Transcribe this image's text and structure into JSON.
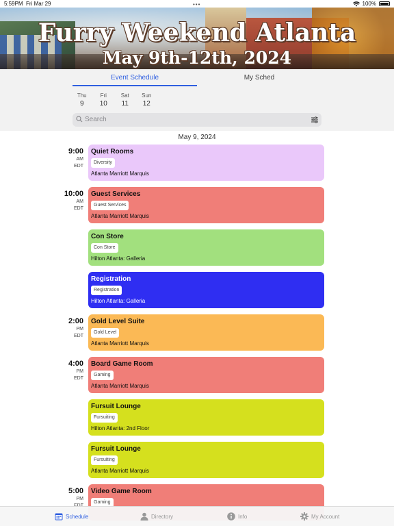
{
  "status": {
    "time": "5:59PM",
    "date": "Fri Mar 29",
    "battery": "100%"
  },
  "banner": {
    "title": "Furry Weekend Atlanta",
    "subtitle": "May 9th-12th, 2024"
  },
  "tabs": [
    {
      "label": "Event Schedule",
      "active": true
    },
    {
      "label": "My Sched",
      "active": false
    }
  ],
  "days": [
    {
      "dow": "Thu",
      "num": "9"
    },
    {
      "dow": "Fri",
      "num": "10"
    },
    {
      "dow": "Sat",
      "num": "11"
    },
    {
      "dow": "Sun",
      "num": "12"
    }
  ],
  "search": {
    "placeholder": "Search",
    "icon": "search-icon",
    "filter_icon": "filter-icon"
  },
  "date_heading": "May 9, 2024",
  "times": [
    {
      "hm": "9:00",
      "ampm": "AM",
      "tz": "EDT"
    },
    {
      "hm": "10:00",
      "ampm": "AM",
      "tz": "EDT"
    },
    {
      "hm": "2:00",
      "ampm": "PM",
      "tz": "EDT"
    },
    {
      "hm": "4:00",
      "ampm": "PM",
      "tz": "EDT"
    },
    {
      "hm": "5:00",
      "ampm": "PM",
      "tz": "EDT"
    }
  ],
  "events": [
    {
      "name": "Quiet Rooms",
      "tag": "Diversity",
      "location": "Atlanta Marriott Marquis",
      "color": "#eac8fa"
    },
    {
      "name": "Guest Services",
      "tag": "Guest Services",
      "location": "Atlanta Marriott Marquis",
      "color": "#f07e78"
    },
    {
      "name": "Con Store",
      "tag": "Con Store",
      "location": "Hilton Atlanta: Galleria",
      "color": "#a2e07e"
    },
    {
      "name": "Registration",
      "tag": "Registration",
      "location": "Hilton Atlanta: Galleria",
      "color": "#2f2ef2"
    },
    {
      "name": "Gold Level Suite",
      "tag": "Gold Level",
      "location": "Atlanta Marriott Marquis",
      "color": "#fbb955"
    },
    {
      "name": "Board Game Room",
      "tag": "Gaming",
      "location": "Atlanta Marriott Marquis",
      "color": "#f07e78"
    },
    {
      "name": "Fursuit Lounge",
      "tag": "Fursuiting",
      "location": "Hilton Atlanta: 2nd Floor",
      "color": "#d5e01e"
    },
    {
      "name": "Fursuit Lounge",
      "tag": "Fursuiting",
      "location": "Atlanta Marriott Marquis",
      "color": "#d5e01e"
    },
    {
      "name": "Video Game Room",
      "tag": "Gaming",
      "location": "",
      "color": "#f07e78"
    }
  ],
  "bottom_nav": [
    {
      "label": "Schedule",
      "icon": "calendar-icon",
      "active": true
    },
    {
      "label": "Directory",
      "icon": "person-icon",
      "active": false
    },
    {
      "label": "Info",
      "icon": "info-icon",
      "active": false
    },
    {
      "label": "My Account",
      "icon": "gear-icon",
      "active": false
    }
  ],
  "colors": {
    "accent": "#2f5fe0"
  }
}
